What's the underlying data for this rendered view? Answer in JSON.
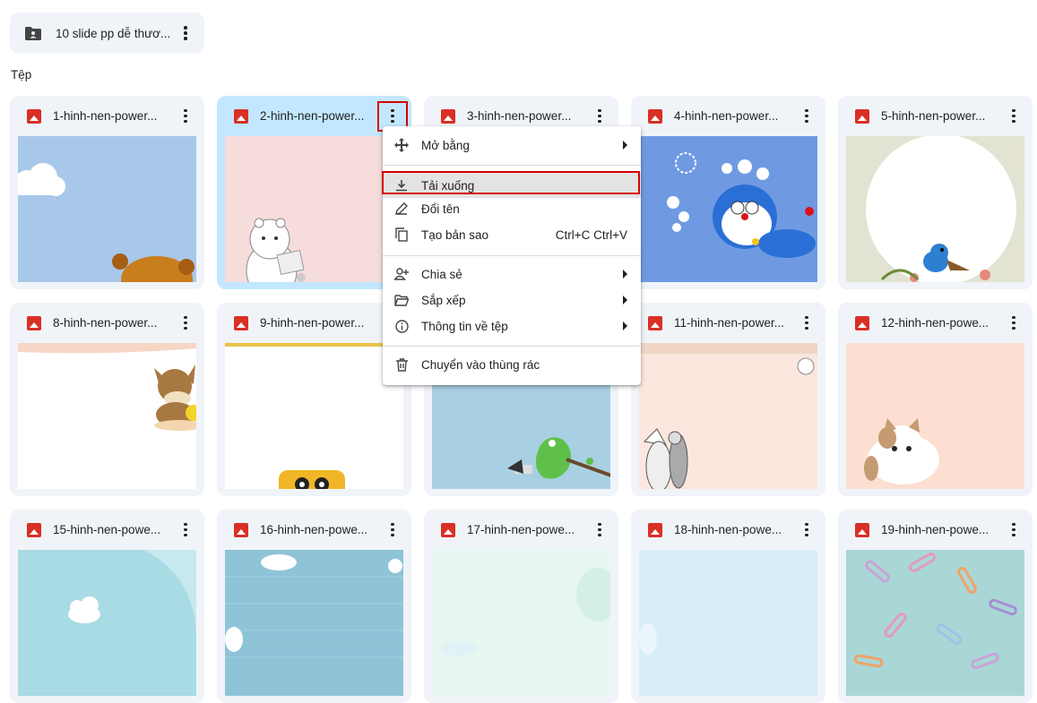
{
  "folder": {
    "name": "10 slide pp dễ thươ..."
  },
  "section_label": "Tệp",
  "files": [
    "1-hinh-nen-power...",
    "2-hinh-nen-power...",
    "3-hinh-nen-power...",
    "4-hinh-nen-power...",
    "5-hinh-nen-power...",
    "8-hinh-nen-power...",
    "9-hinh-nen-power...",
    "",
    "11-hinh-nen-power...",
    "12-hinh-nen-powe...",
    "15-hinh-nen-powe...",
    "16-hinh-nen-powe...",
    "17-hinh-nen-powe...",
    "18-hinh-nen-powe...",
    "19-hinh-nen-powe..."
  ],
  "context_menu": {
    "open_with": "Mở bằng",
    "download": "Tải xuống",
    "rename": "Đổi tên",
    "make_copy": "Tạo bản sao",
    "make_copy_shortcut": "Ctrl+C Ctrl+V",
    "share": "Chia sẻ",
    "organize": "Sắp xếp",
    "file_info": "Thông tin về tệp",
    "trash": "Chuyển vào thùng rác"
  },
  "colors": {
    "accent": "#c2e7ff",
    "card_bg": "#f0f4f9",
    "highlight": "#d40000",
    "image_icon": "#d93025"
  }
}
